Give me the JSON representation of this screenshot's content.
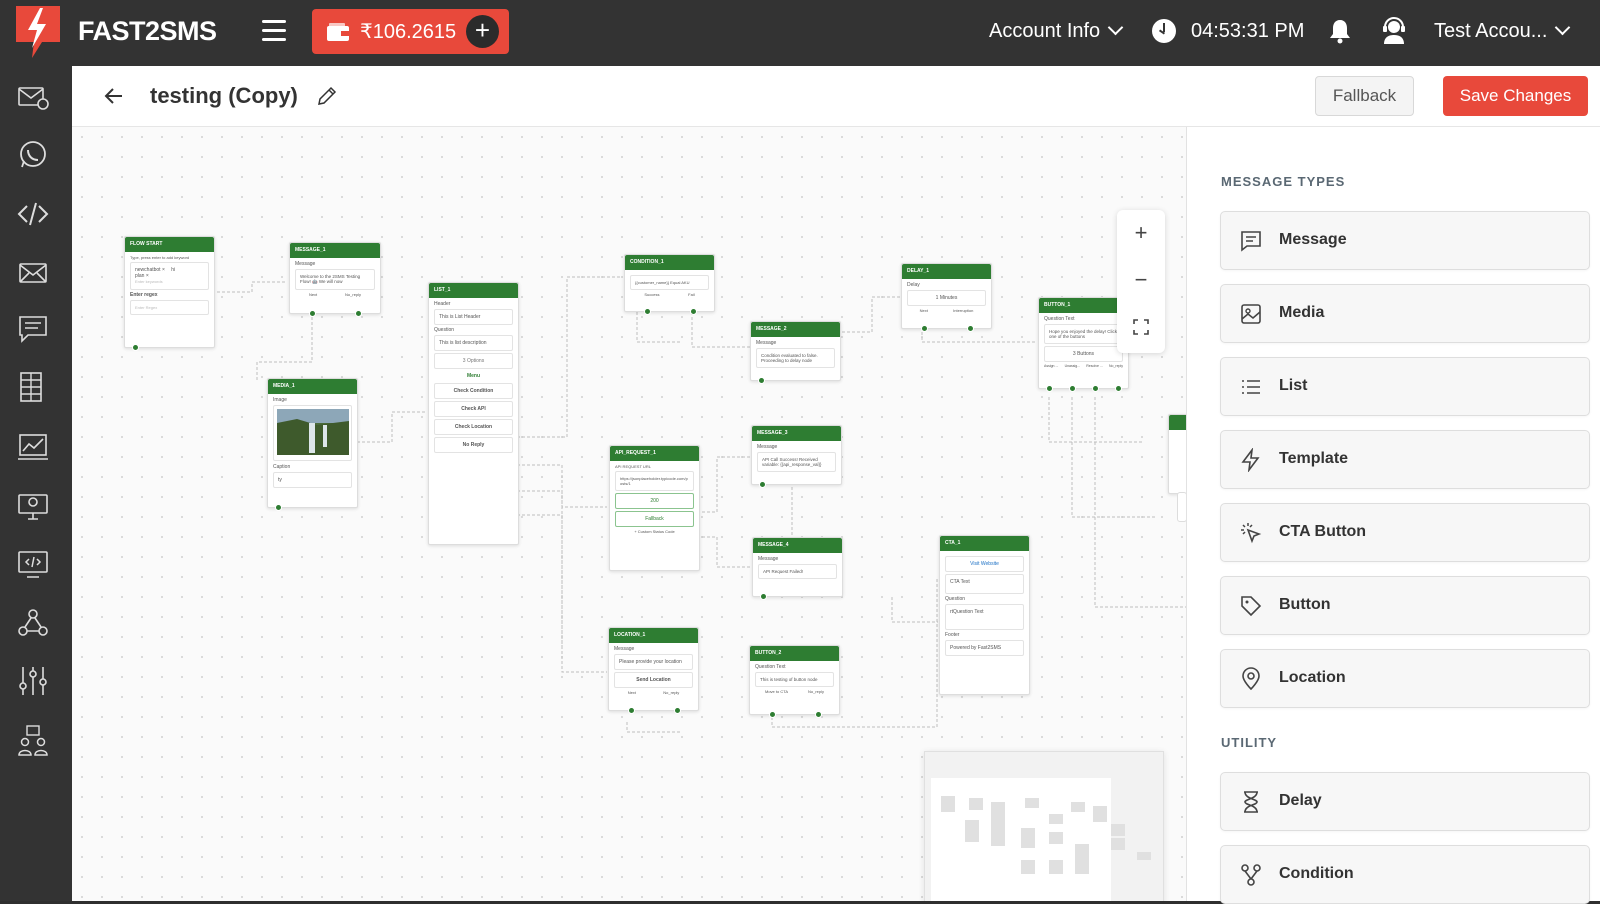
{
  "header": {
    "brand": "FAST2SMS",
    "wallet_balance": "₹106.2615",
    "account_menu": "Account Info",
    "time": "04:53:31 PM",
    "user_menu": "Test Accou..."
  },
  "sidebar": {
    "items": [
      "email-icon",
      "whatsapp-icon",
      "code-icon",
      "mail-icon",
      "chat-icon",
      "document-icon",
      "analytics-icon",
      "computer-icon",
      "dev-monitor-icon",
      "webhook-icon",
      "settings-sliders-icon",
      "referral-icon"
    ]
  },
  "toolbar": {
    "title": "testing (Copy)",
    "fallback_label": "Fallback",
    "save_label": "Save Changes"
  },
  "panel": {
    "section1": "MESSAGE TYPES",
    "message_types": [
      "Message",
      "Media",
      "List",
      "Template",
      "CTA Button",
      "Button",
      "Location"
    ],
    "section2": "UTILITY",
    "utility": [
      "Delay",
      "Condition"
    ]
  },
  "flow": {
    "start": {
      "title": "FLOW START",
      "hint": "Type, press enter to add keyword",
      "kw1": "newchatbot",
      "kw2": "hi",
      "kw3": "plan",
      "kw_placeholder": "Enter keywords",
      "regex_label": "Enter regex",
      "regex_placeholder": "Enter Regex"
    },
    "message1": {
      "title": "MESSAGE_1",
      "label": "Message",
      "text": "Welcome to the 2SMS Testing Flow! 🤖 We will now",
      "next": "Next",
      "noreply": "No_reply"
    },
    "media1": {
      "title": "MEDIA_1",
      "label": "Image",
      "caption_label": "Caption",
      "caption": "ty"
    },
    "list1": {
      "title": "LIST_1",
      "header_label": "Header",
      "header": "This is List Header",
      "question_label": "Question",
      "question": "This is list description",
      "options": "3 Options",
      "menu": "Menu",
      "items": [
        "Check Condition",
        "Check API",
        "Check Location",
        "No Reply"
      ]
    },
    "condition1": {
      "title": "CONDITION_1",
      "cond": "{{customer_name}} Equal AKU",
      "success": "Success",
      "fail": "Fail"
    },
    "message2": {
      "title": "MESSAGE_2",
      "label": "Message",
      "text": "Condition evaluated to false. Proceeding to delay node"
    },
    "delay1": {
      "title": "DELAY_1",
      "label": "Delay",
      "value": "1 Minutes",
      "next": "Next",
      "interruption": "Interruption"
    },
    "button1": {
      "title": "BUTTON_1",
      "label": "Question Text",
      "text": "Hope you enjoyed the delay! Click one of the buttons",
      "buttons": "3 Buttons",
      "outs": [
        "Assign ...",
        "Unassig...",
        "Resolve ...",
        "No_reply"
      ]
    },
    "api1": {
      "title": "API_REQUEST_1",
      "label": "API REQUEST URL",
      "url": "https://jsonplaceholder.typicode.com/posts/1",
      "status": "200",
      "fallback": "Fallback",
      "custom": "+ Custom Status Code"
    },
    "message3": {
      "title": "MESSAGE_3",
      "label": "Message",
      "text": "API Call Success! Received variable: {{api_response_val}}"
    },
    "message4": {
      "title": "MESSAGE_4",
      "label": "Message",
      "text": "API Request Failed!"
    },
    "cta1": {
      "title": "CTA_1",
      "button": "Visit Website",
      "text": "CTA Text",
      "question_label": "Question",
      "question": "rtQuestion Text",
      "footer_label": "Footer",
      "footer": "Powered by Fast2SMS"
    },
    "location1": {
      "title": "LOCATION_1",
      "label": "Message",
      "text": "Please provide your location",
      "send": "Send Location",
      "next": "Next",
      "noreply": "No_reply"
    },
    "button2": {
      "title": "BUTTON_2",
      "label": "Question Text",
      "text": "This is testing of button node",
      "outs": [
        "Move to CTA",
        "No_reply"
      ]
    }
  },
  "colors": {
    "accent": "#e8493b",
    "node_header": "#2e7d32",
    "topbar": "#333333"
  }
}
